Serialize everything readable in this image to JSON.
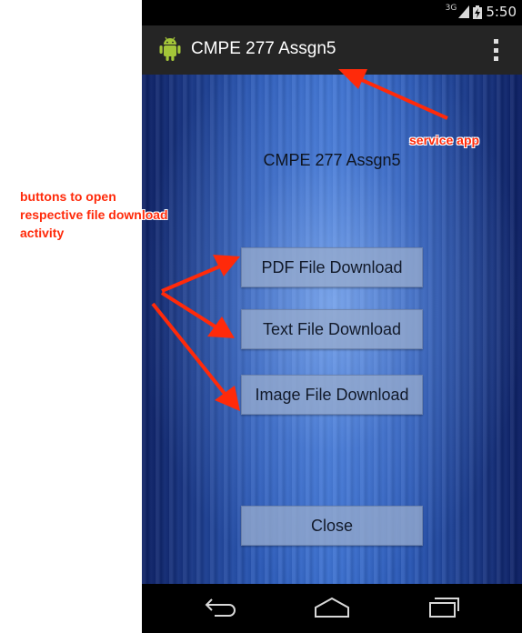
{
  "status_bar": {
    "network": "3G",
    "time": "5:50"
  },
  "action_bar": {
    "title": "CMPE 277 Assgn5"
  },
  "main": {
    "heading": "CMPE 277 Assgn5",
    "buttons": [
      {
        "label": "PDF File Download"
      },
      {
        "label": "Text File Download"
      },
      {
        "label": "Image File Download"
      }
    ],
    "close_label": "Close"
  },
  "nav": {
    "icons": [
      "back-icon",
      "home-icon",
      "recents-icon"
    ]
  },
  "annotations": {
    "service_app": "service app",
    "buttons_note": [
      "buttons to open",
      "respective file download",
      "activity"
    ]
  },
  "colors": {
    "annotation": "#ff2a0a",
    "action_bar": "#252525",
    "background_blue": "#2a58b6"
  }
}
